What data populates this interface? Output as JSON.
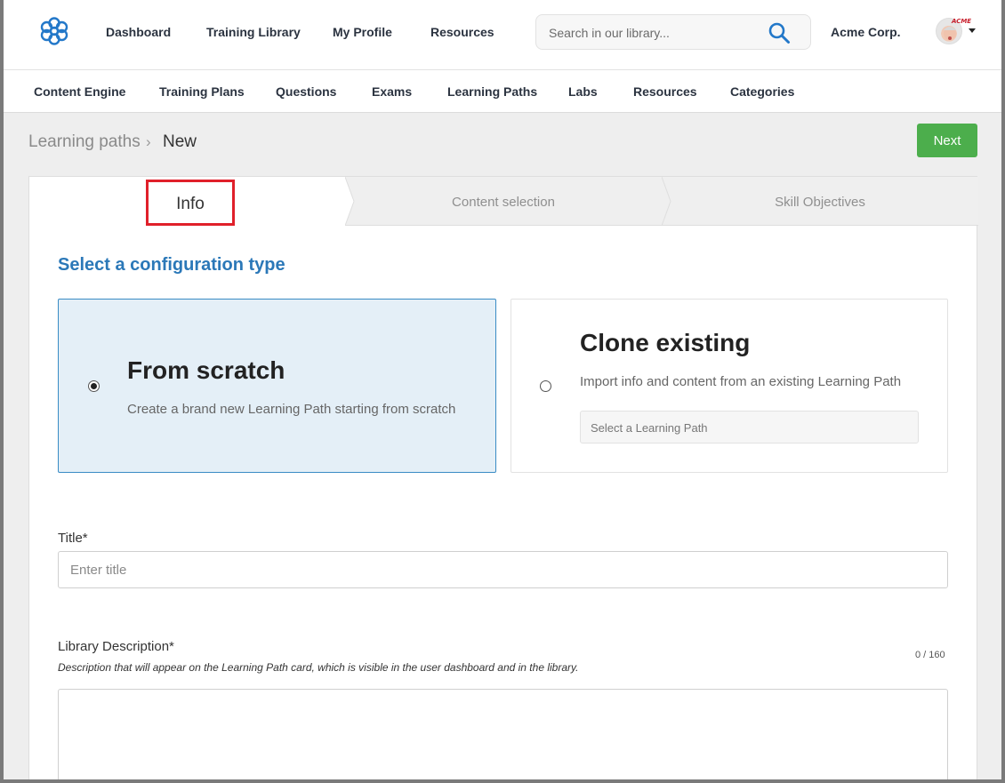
{
  "topnav": {
    "links": [
      "Dashboard",
      "Training Library",
      "My Profile",
      "Resources"
    ],
    "search_placeholder": "Search in our library...",
    "org_name": "Acme Corp.",
    "avatar_tag": "ACME"
  },
  "subnav": {
    "links": [
      "Content Engine",
      "Training Plans",
      "Questions",
      "Exams",
      "Learning Paths",
      "Labs",
      "Resources",
      "Categories"
    ]
  },
  "breadcrumb": {
    "root": "Learning paths",
    "separator": "›",
    "current": "New"
  },
  "next_label": "Next",
  "steps": [
    "Info",
    "Content selection",
    "Skill Objectives"
  ],
  "config": {
    "title": "Select a configuration type",
    "scratch": {
      "heading": "From scratch",
      "description": "Create a brand new Learning Path starting from scratch"
    },
    "clone": {
      "heading": "Clone existing",
      "description": "Import info and content from an existing Learning Path",
      "select_placeholder": "Select a Learning Path"
    }
  },
  "form": {
    "title_label": "Title*",
    "title_placeholder": "Enter title",
    "desc_label": "Library Description*",
    "desc_hint": "Description that will appear on the Learning Path card, which is visible in the user dashboard and in the library.",
    "desc_counter": "0 / 160"
  },
  "colors": {
    "accent_blue": "#2b78b8",
    "next_green": "#4cae4c",
    "highlight_red": "#e0202a"
  }
}
